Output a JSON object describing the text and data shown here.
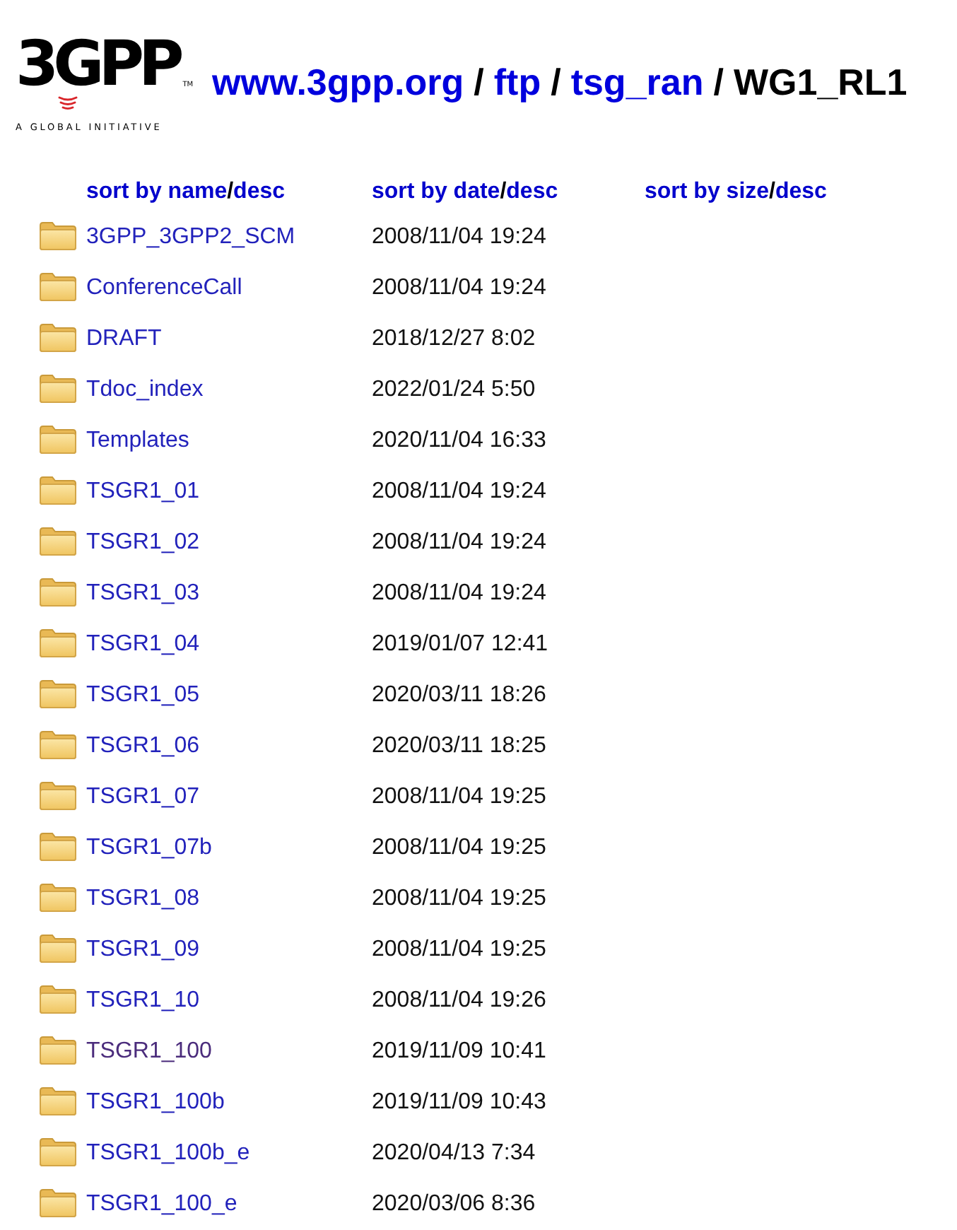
{
  "logo": {
    "wordmark": "3GPP",
    "trademark": "TM",
    "tagline": "A GLOBAL INITIATIVE"
  },
  "breadcrumb": [
    {
      "kind": "link",
      "label": "www.3gpp.org"
    },
    {
      "kind": "separator",
      "label": "/"
    },
    {
      "kind": "link",
      "label": "ftp"
    },
    {
      "kind": "separator",
      "label": "/"
    },
    {
      "kind": "link",
      "label": "tsg_ran"
    },
    {
      "kind": "separator",
      "label": "/"
    },
    {
      "kind": "current",
      "label": "WG1_RL1"
    }
  ],
  "columns": [
    {
      "sort": "sort by name",
      "separator": "/",
      "desc": "desc"
    },
    {
      "sort": "sort by date",
      "separator": "/",
      "desc": "desc"
    },
    {
      "sort": "sort by size",
      "separator": "/",
      "desc": "desc"
    }
  ],
  "rows": [
    {
      "name": "3GPP_3GPP2_SCM",
      "date": "2008/11/04 19:24",
      "visited": false
    },
    {
      "name": "ConferenceCall",
      "date": "2008/11/04 19:24",
      "visited": false
    },
    {
      "name": "DRAFT",
      "date": "2018/12/27 8:02",
      "visited": false
    },
    {
      "name": "Tdoc_index",
      "date": "2022/01/24 5:50",
      "visited": false
    },
    {
      "name": "Templates",
      "date": "2020/11/04 16:33",
      "visited": false
    },
    {
      "name": "TSGR1_01",
      "date": "2008/11/04 19:24",
      "visited": false
    },
    {
      "name": "TSGR1_02",
      "date": "2008/11/04 19:24",
      "visited": false
    },
    {
      "name": "TSGR1_03",
      "date": "2008/11/04 19:24",
      "visited": false
    },
    {
      "name": "TSGR1_04",
      "date": "2019/01/07 12:41",
      "visited": false
    },
    {
      "name": "TSGR1_05",
      "date": "2020/03/11 18:26",
      "visited": false
    },
    {
      "name": "TSGR1_06",
      "date": "2020/03/11 18:25",
      "visited": false
    },
    {
      "name": "TSGR1_07",
      "date": "2008/11/04 19:25",
      "visited": false
    },
    {
      "name": "TSGR1_07b",
      "date": "2008/11/04 19:25",
      "visited": false
    },
    {
      "name": "TSGR1_08",
      "date": "2008/11/04 19:25",
      "visited": false
    },
    {
      "name": "TSGR1_09",
      "date": "2008/11/04 19:25",
      "visited": false
    },
    {
      "name": "TSGR1_10",
      "date": "2008/11/04 19:26",
      "visited": false
    },
    {
      "name": "TSGR1_100",
      "date": "2019/11/09 10:41",
      "visited": true
    },
    {
      "name": "TSGR1_100b",
      "date": "2019/11/09 10:43",
      "visited": false
    },
    {
      "name": "TSGR1_100b_e",
      "date": "2020/04/13 7:34",
      "visited": false
    },
    {
      "name": "TSGR1_100_e",
      "date": "2020/03/06 8:36",
      "visited": false
    }
  ]
}
